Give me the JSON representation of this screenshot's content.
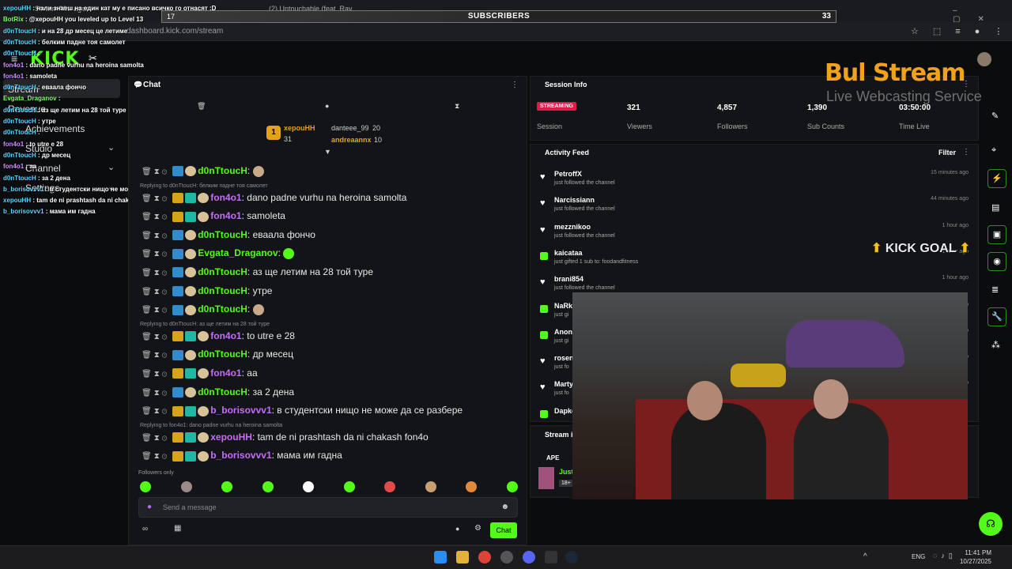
{
  "browser": {
    "tabs": [
      "Stream Manager",
      "(2) Untouchable (feat. Rav..."
    ],
    "url": "dashboard.kick.com/stream"
  },
  "subscribers_bar": {
    "current": "17",
    "label": "SUBSCRIBERS",
    "goal": "33",
    "progress_fraction": 0.52
  },
  "sidebar": {
    "items": [
      "Stream",
      "Revenue",
      "Achievements",
      "Studio",
      "Channel",
      "Settings"
    ]
  },
  "overlay_chat": [
    {
      "name": "xepouHH",
      "text": "нали знаеш на един кат му е писано всичко го отнасят :D"
    },
    {
      "name": "BotRix",
      "text": "@xepouHH you leveled up to Level 13"
    },
    {
      "name": "d0nTtoucH",
      "text": "и на 28 др месец це летиме"
    },
    {
      "name": "d0nTtoucH",
      "text": "белким падне тоя самолет"
    },
    {
      "name": "d0nTtoucH",
      "text": ""
    },
    {
      "name": "fon4o1",
      "text": "dano padne vurhu na heroina samolta"
    },
    {
      "name": "fon4o1",
      "text": "samoleta"
    },
    {
      "name": "d0nTtoucH",
      "text": "еваала фончо"
    },
    {
      "name": "Evgata_Draganov",
      "text": ""
    },
    {
      "name": "d0nTtoucH",
      "text": "аз ще летим на 28 той туре"
    },
    {
      "name": "d0nTtoucH",
      "text": "утре"
    },
    {
      "name": "d0nTtoucH",
      "text": ""
    },
    {
      "name": "fon4o1",
      "text": "to utre e 28"
    },
    {
      "name": "d0nTtoucH",
      "text": "др месец"
    },
    {
      "name": "fon4o1",
      "text": "aa"
    },
    {
      "name": "d0nTtoucH",
      "text": "за 2 дена"
    },
    {
      "name": "b_borisovvv1",
      "text": "в студентски нищо не може да се разбере"
    },
    {
      "name": "xepouHH",
      "text": "tam de ni prashtash da ni chakash fon4o"
    },
    {
      "name": "b_borisovvv1",
      "text": "мама им гадна"
    }
  ],
  "chat": {
    "title": "Chat",
    "leaderboard": [
      {
        "rank": "1",
        "name": "xepouHH",
        "score": "31"
      },
      {
        "name": "danteee_99",
        "score": "20"
      },
      {
        "name": "andreaannx",
        "score": "10"
      }
    ],
    "messages": [
      {
        "name": "d0nTtoucH",
        "text": "",
        "color": "#53fc18"
      },
      {
        "name": "fon4o1",
        "text": "dano padne vurhu na heroina samolta",
        "color": "#c86bff",
        "reply": "Replying to d0nTtoucH: белким падне тоя самолет"
      },
      {
        "name": "fon4o1",
        "text": "samoleta",
        "color": "#c86bff"
      },
      {
        "name": "d0nTtoucH",
        "text": "еваала фончо",
        "color": "#53fc18"
      },
      {
        "name": "Evgata_Draganov",
        "text": "",
        "color": "#53fc18"
      },
      {
        "name": "d0nTtoucH",
        "text": "аз ще летим на 28 той туре",
        "color": "#53fc18"
      },
      {
        "name": "d0nTtoucH",
        "text": "утре",
        "color": "#53fc18"
      },
      {
        "name": "d0nTtoucH",
        "text": "",
        "color": "#53fc18"
      },
      {
        "name": "fon4o1",
        "text": "to utre e 28",
        "color": "#c86bff",
        "reply": "Replying to d0nTtoucH: аз ще летим на 28 той туре"
      },
      {
        "name": "d0nTtoucH",
        "text": "др месец",
        "color": "#53fc18"
      },
      {
        "name": "fon4o1",
        "text": "aa",
        "color": "#c86bff"
      },
      {
        "name": "d0nTtoucH",
        "text": "за 2 дена",
        "color": "#53fc18"
      },
      {
        "name": "b_borisovvv1",
        "text": "в студентски нищо не може да се разбере",
        "color": "#c86bff"
      },
      {
        "name": "xepouHH",
        "text": "tam de ni prashtash da ni chakash fon4o",
        "color": "#c86bff",
        "reply": "Replying to fon4o1: dano padne vurhu na heroina samolta"
      },
      {
        "name": "b_borisovvv1",
        "text": "мама им гадна",
        "color": "#c86bff"
      }
    ],
    "followers_only": "Followers only",
    "input_placeholder": "Send a message",
    "send_label": "Chat"
  },
  "session": {
    "title": "Session Info",
    "status": "STREAMING",
    "status_label": "Session",
    "stats": [
      {
        "value": "321",
        "label": "Viewers"
      },
      {
        "value": "4,857",
        "label": "Followers"
      },
      {
        "value": "1,390",
        "label": "Sub Counts"
      },
      {
        "value": "03:50:00",
        "label": "Time Live"
      }
    ]
  },
  "activity": {
    "title": "Activity Feed",
    "filter_label": "Filter",
    "items": [
      {
        "name": "PetroffX",
        "sub": "just followed the channel",
        "time": "15 minutes ago",
        "kind": "follow"
      },
      {
        "name": "Narcissiann",
        "sub": "just followed the channel",
        "time": "44 minutes ago",
        "kind": "follow"
      },
      {
        "name": "mezznikoo",
        "sub": "just followed the channel",
        "time": "1 hour ago",
        "kind": "follow"
      },
      {
        "name": "kaicataa",
        "sub": "just gifted 1 sub to: foodandfitness",
        "time": "1 hour ago",
        "kind": "gift"
      },
      {
        "name": "brani854",
        "sub": "just followed the channel",
        "time": "1 hour ago",
        "kind": "follow"
      },
      {
        "name": "NaRk",
        "sub": "just gi",
        "time": "ago",
        "kind": "gift"
      },
      {
        "name": "Anony",
        "sub": "just gi",
        "time": "ago",
        "kind": "gift"
      },
      {
        "name": "rosen",
        "sub": "just fo",
        "time": "ago",
        "kind": "follow"
      },
      {
        "name": "Marty",
        "sub": "just fo",
        "time": "ago",
        "kind": "follow"
      },
      {
        "name": "Dapko",
        "sub": "",
        "time": "",
        "kind": "gift"
      }
    ]
  },
  "stream_info": {
    "title": "Stream i",
    "row1": "APE",
    "row2": "Just",
    "row3": "18+"
  },
  "branding": {
    "bul": "Bul",
    "stream": "Stream",
    "sub": "Live Webcasting Services",
    "kick_goal": "KICK GOAL"
  },
  "taskbar": {
    "lang": "ENG",
    "time": "11:41 PM",
    "date": "10/27/2025"
  },
  "colors": {
    "kick_green": "#53fc18",
    "bg": "#0b0c0e",
    "panel": "#131417",
    "bul_orange": "#f0a31a"
  }
}
